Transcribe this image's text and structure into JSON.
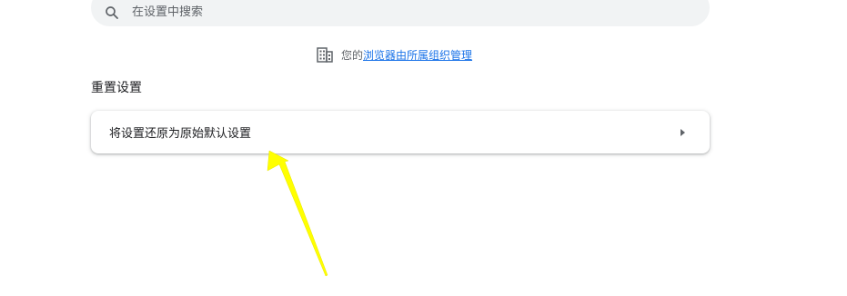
{
  "search": {
    "placeholder": "在设置中搜索",
    "icon": "search-icon"
  },
  "managed_notice": {
    "icon": "building-icon",
    "prefix": "您的",
    "link_text": "浏览器由所属组织管理"
  },
  "reset_section": {
    "title": "重置设置",
    "items": [
      {
        "label": "将设置还原为原始默认设置",
        "icon": "arrow-right-icon"
      }
    ]
  },
  "annotation": {
    "type": "yellow-arrow",
    "color": "#ffff00"
  },
  "colors": {
    "link": "#1a73e8",
    "search_bg": "#f1f3f4",
    "text_secondary": "#5f6368"
  }
}
